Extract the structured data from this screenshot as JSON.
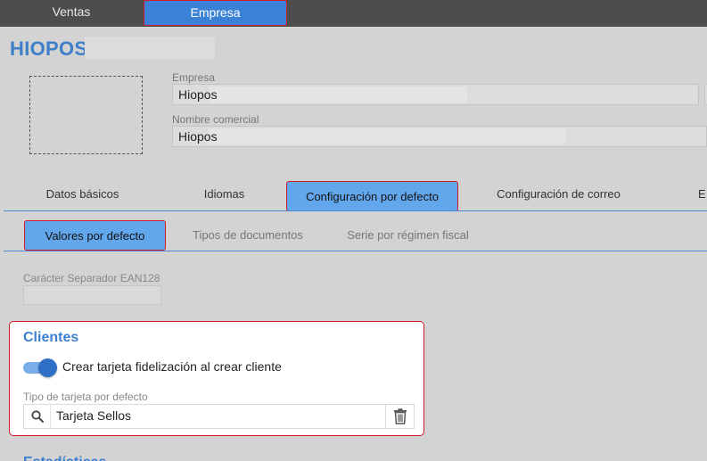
{
  "topbar": {
    "tabs": [
      {
        "label": "Ventas",
        "active": false
      },
      {
        "label": "Empresa",
        "active": true
      }
    ]
  },
  "header": {
    "company_name": "HIOPOS"
  },
  "fields": {
    "empresa": {
      "label": "Empresa",
      "value": "Hiopos"
    },
    "nombre_comercial": {
      "label": "Nombre comercial",
      "value": "Hiopos"
    }
  },
  "main_tabs": [
    {
      "label": "Datos básicos",
      "active": false
    },
    {
      "label": "Idiomas",
      "active": false
    },
    {
      "label": "Configuración por defecto",
      "active": true
    },
    {
      "label": "Configuración de correo",
      "active": false
    },
    {
      "label": "E",
      "active": false
    }
  ],
  "sub_tabs": [
    {
      "label": "Valores por defecto",
      "active": true
    },
    {
      "label": "Tipos de documentos",
      "active": false
    },
    {
      "label": "Serie por régimen fiscal",
      "active": false
    }
  ],
  "ean": {
    "label": "Carácter Separador EAN128",
    "value": ""
  },
  "clientes": {
    "title": "Clientes",
    "toggle": {
      "label": "Crear tarjeta fidelización al crear cliente",
      "on": true
    },
    "card_type": {
      "label": "Tipo de tarjeta por defecto",
      "value": "Tarjeta Sellos"
    }
  },
  "next_section": {
    "title": "Estadísticas"
  },
  "icons": {
    "search": "search-icon",
    "delete": "trash-icon"
  },
  "colors": {
    "accent": "#3b82d6",
    "tab_active": "#62a6ec",
    "highlight_border": "#d11a2a",
    "title": "#3f7fc9"
  }
}
